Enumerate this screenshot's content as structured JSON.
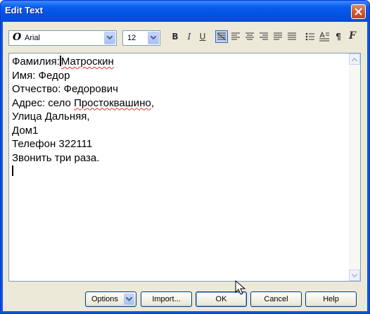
{
  "window": {
    "title": "Edit Text"
  },
  "toolbar": {
    "font_name": "Arial",
    "font_size": "12",
    "bold_glyph": "B",
    "italic_glyph": "I",
    "underline_glyph": "U",
    "paragraph_glyph": "¶"
  },
  "editor": {
    "lines": [
      "Фамилия:",
      "Матроскин",
      "Имя: Федор",
      "Отчество: Федорович",
      "Адрес: село ",
      "Простоквашино",
      ",",
      "Улица Дальняя,",
      "Дом1",
      "Телефон 322111",
      "Звонить три раза."
    ]
  },
  "buttons": {
    "options": "Options",
    "import": "Import...",
    "ok": "OK",
    "cancel": "Cancel",
    "help": "Help"
  },
  "colors": {
    "title_bar": "#0a5cef",
    "close_button": "#d35a2e",
    "dialog_face": "#ece9d8",
    "misspelling_underline": "#e03030"
  }
}
